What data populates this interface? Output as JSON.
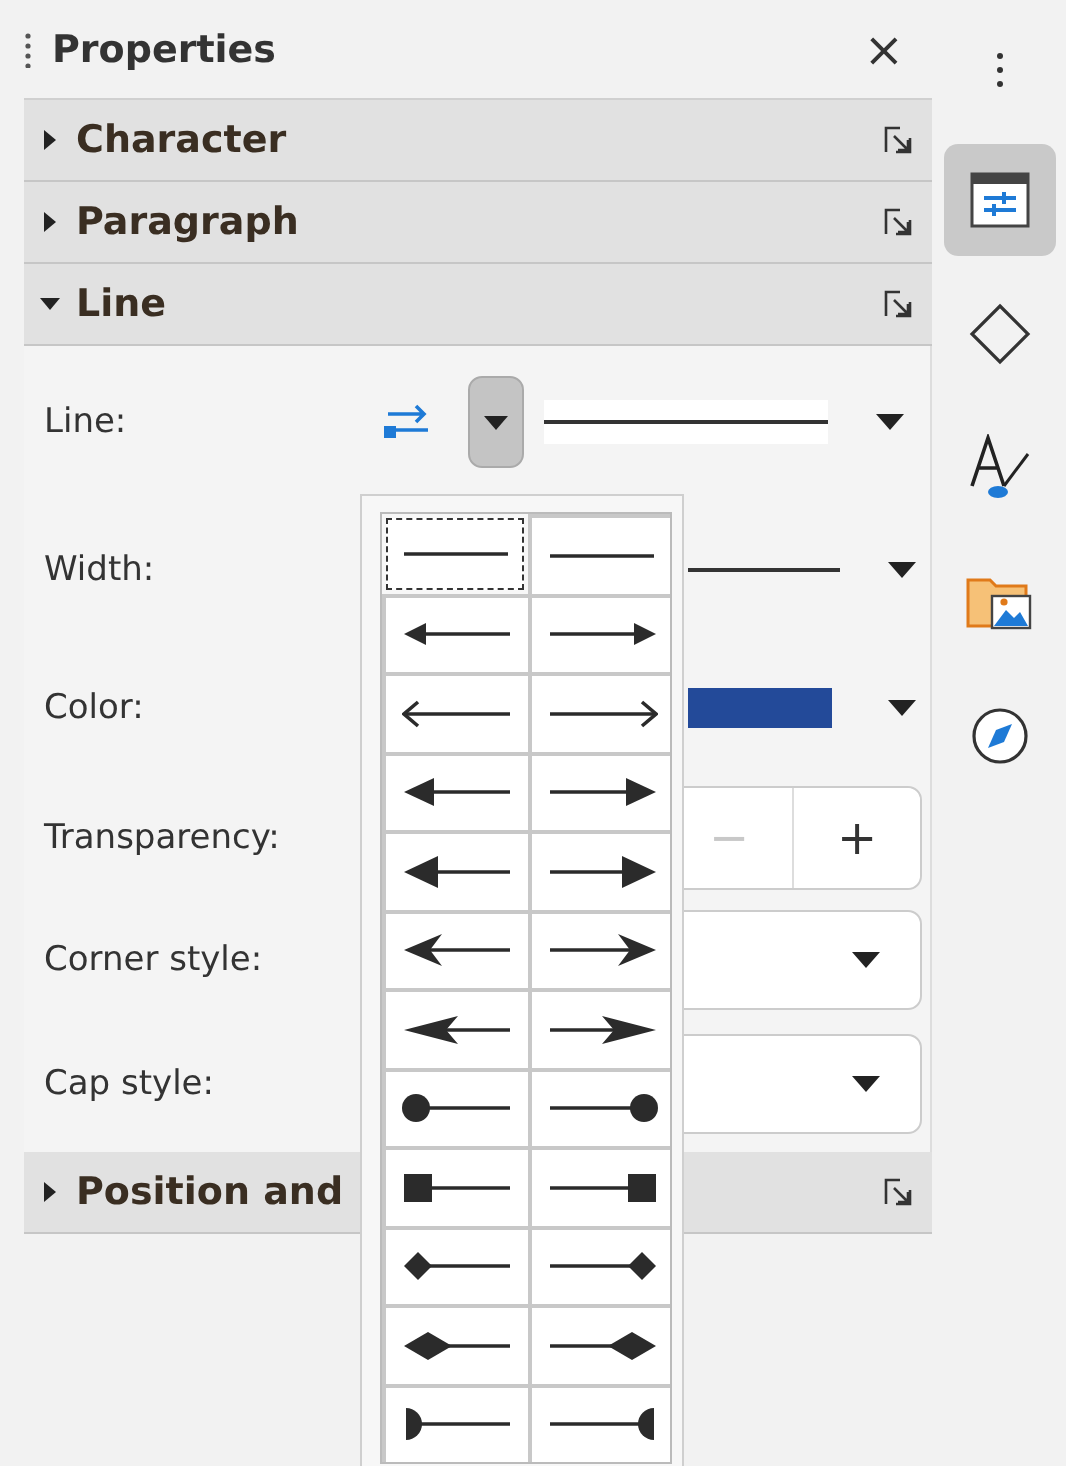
{
  "panel": {
    "title": "Properties",
    "close": "×"
  },
  "sections": [
    {
      "title": "Character",
      "expanded": false
    },
    {
      "title": "Paragraph",
      "expanded": false
    },
    {
      "title": "Line",
      "expanded": true,
      "fields": [
        {
          "kind": "line-style",
          "label": "Line:",
          "pressed": true
        },
        {
          "kind": "width",
          "label": "Width:"
        },
        {
          "kind": "color",
          "label": "Color:",
          "color": "#234a99"
        },
        {
          "kind": "spin",
          "label": "Transparency:",
          "buttons": [
            {
              "label": "−",
              "disabled": true
            },
            {
              "label": "+",
              "disabled": false
            }
          ]
        },
        {
          "kind": "select",
          "label": "Corner style:"
        },
        {
          "kind": "select",
          "label": "Cap style:"
        }
      ]
    },
    {
      "title": "Position and",
      "expanded": false
    }
  ],
  "arrow_style_popup": {
    "rows": [
      {
        "kind": "none",
        "cells": [
          {
            "selected": true
          },
          {
            "selected": false
          }
        ]
      },
      {
        "kind": "arrow-short",
        "cells": [
          {
            "selected": false
          },
          {
            "selected": false
          }
        ]
      },
      {
        "kind": "arrow-open",
        "cells": [
          {
            "selected": false
          },
          {
            "selected": false
          }
        ]
      },
      {
        "kind": "arrow",
        "cells": [
          {
            "selected": false
          },
          {
            "selected": false
          }
        ]
      },
      {
        "kind": "triangle",
        "cells": [
          {
            "selected": false
          },
          {
            "selected": false
          }
        ]
      },
      {
        "kind": "concave",
        "cells": [
          {
            "selected": false
          },
          {
            "selected": false
          }
        ]
      },
      {
        "kind": "concave-large",
        "cells": [
          {
            "selected": false
          },
          {
            "selected": false
          }
        ]
      },
      {
        "kind": "circle",
        "cells": [
          {
            "selected": false
          },
          {
            "selected": false
          }
        ]
      },
      {
        "kind": "square",
        "cells": [
          {
            "selected": false
          },
          {
            "selected": false
          }
        ]
      },
      {
        "kind": "diamond",
        "cells": [
          {
            "selected": false
          },
          {
            "selected": false
          }
        ]
      },
      {
        "kind": "diamond-large",
        "cells": [
          {
            "selected": false
          },
          {
            "selected": false
          }
        ]
      },
      {
        "kind": "half-circle",
        "cells": [
          {
            "selected": false
          },
          {
            "selected": false
          }
        ]
      }
    ]
  },
  "sidebar_tabs": [
    {
      "kind": "properties",
      "selected": true
    },
    {
      "kind": "shapes",
      "selected": false
    },
    {
      "kind": "styles",
      "selected": false
    },
    {
      "kind": "gallery",
      "selected": false
    },
    {
      "kind": "navigator",
      "selected": false
    }
  ]
}
